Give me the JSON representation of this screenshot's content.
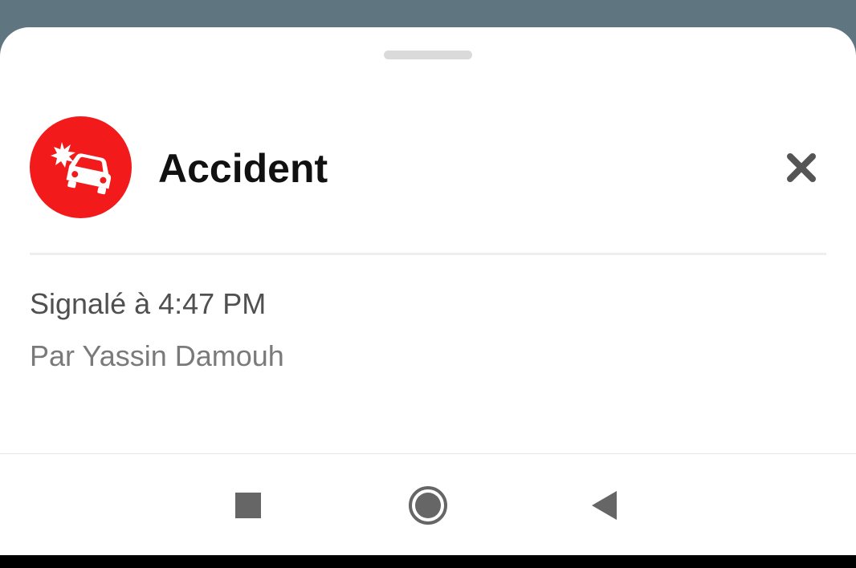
{
  "sheet": {
    "title": "Accident",
    "reported_text": "Signalé à 4:47 PM",
    "author_text": "Par Yassin Damouh",
    "icon": "car-crash-icon",
    "icon_color": "#f21a1a",
    "close_icon": "close-icon"
  },
  "navbar": {
    "recent_icon": "recent-apps-icon",
    "home_icon": "home-icon",
    "back_icon": "back-icon"
  }
}
